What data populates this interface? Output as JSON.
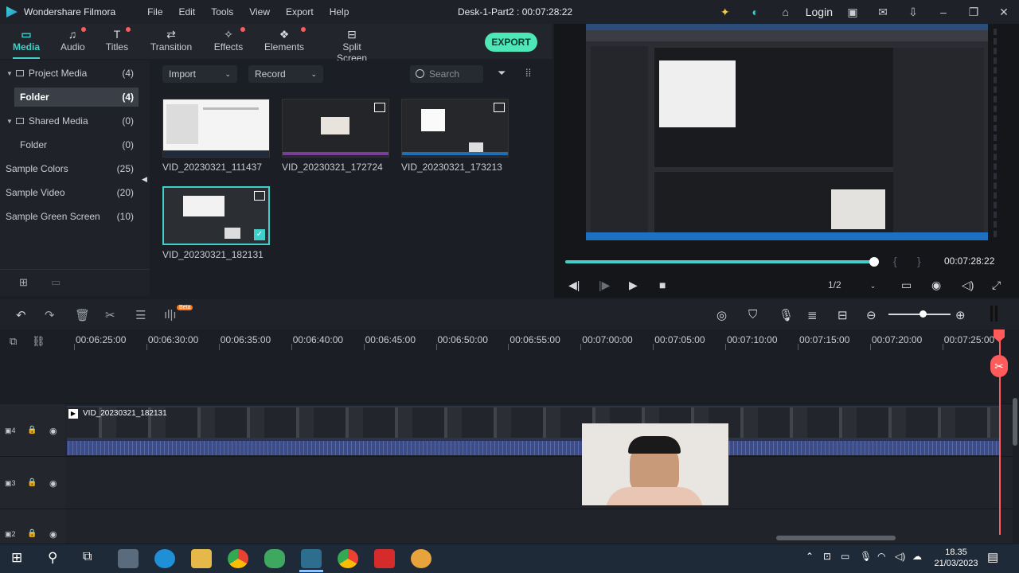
{
  "titlebar": {
    "app_name": "Wondershare Filmora",
    "menu": [
      "File",
      "Edit",
      "Tools",
      "View",
      "Export",
      "Help"
    ],
    "document": "Desk-1-Part2 : 00:07:28:22",
    "login": "Login"
  },
  "media_tabs": [
    {
      "label": "Media",
      "active": true
    },
    {
      "label": "Audio"
    },
    {
      "label": "Titles"
    },
    {
      "label": "Transition"
    },
    {
      "label": "Effects"
    },
    {
      "label": "Elements"
    },
    {
      "label": "Split Screen"
    }
  ],
  "export_label": "EXPORT",
  "folders": [
    {
      "label": "Project Media",
      "count": "(4)"
    },
    {
      "label": "Folder",
      "count": "(4)"
    },
    {
      "label": "Shared Media",
      "count": "(0)"
    },
    {
      "label": "Folder",
      "count": "(0)"
    },
    {
      "label": "Sample Colors",
      "count": "(25)"
    },
    {
      "label": "Sample Video",
      "count": "(20)"
    },
    {
      "label": "Sample Green Screen",
      "count": "(10)"
    }
  ],
  "browser": {
    "import": "Import",
    "record": "Record",
    "search_placeholder": "Search",
    "clips": [
      {
        "name": "VID_20230321_111437"
      },
      {
        "name": "VID_20230321_172724"
      },
      {
        "name": "VID_20230321_173213"
      },
      {
        "name": "VID_20230321_182131",
        "selected": true
      }
    ]
  },
  "preview": {
    "timecode": "00:07:28:22",
    "ratio": "1/2",
    "progress": 0.99
  },
  "timeline": {
    "beta_badge": "Beta",
    "ticks": [
      "00:06:25:00",
      "00:06:30:00",
      "00:06:35:00",
      "00:06:40:00",
      "00:06:45:00",
      "00:06:50:00",
      "00:06:55:00",
      "00:07:00:00",
      "00:07:05:00",
      "00:07:10:00",
      "00:07:15:00",
      "00:07:20:00",
      "00:07:25:00"
    ],
    "clip_name": "VID_20230321_182131",
    "tracks": [
      "4",
      "3",
      "2"
    ]
  },
  "taskbar": {
    "time": "18.35",
    "date": "21/03/2023"
  }
}
